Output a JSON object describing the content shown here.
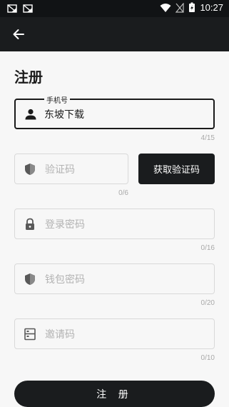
{
  "status_bar": {
    "time": "10:27",
    "icons": [
      "notification-icon",
      "notification-icon",
      "wifi-icon",
      "no-signal-icon",
      "battery-charging-icon"
    ]
  },
  "app_bar": {
    "back_icon": "arrow-left-icon"
  },
  "page": {
    "title": "注册"
  },
  "form": {
    "phone": {
      "label": "手机号",
      "value": "东坡下载",
      "counter": "4/15",
      "icon": "person-icon"
    },
    "code": {
      "placeholder": "验证码",
      "counter": "0/6",
      "icon": "shield-icon",
      "button_label": "获取验证码"
    },
    "login_password": {
      "placeholder": "登录密码",
      "counter": "0/16",
      "icon": "lock-icon"
    },
    "wallet_password": {
      "placeholder": "钱包密码",
      "counter": "0/20",
      "icon": "shield-icon"
    },
    "invite_code": {
      "placeholder": "邀请码",
      "counter": "0/10",
      "icon": "cabinet-icon"
    },
    "submit_label": "注 册"
  },
  "colors": {
    "bar": "#1a1c1e",
    "background": "#f7f7f7",
    "border": "#d9d9d9",
    "placeholder": "#b3b3b3"
  }
}
